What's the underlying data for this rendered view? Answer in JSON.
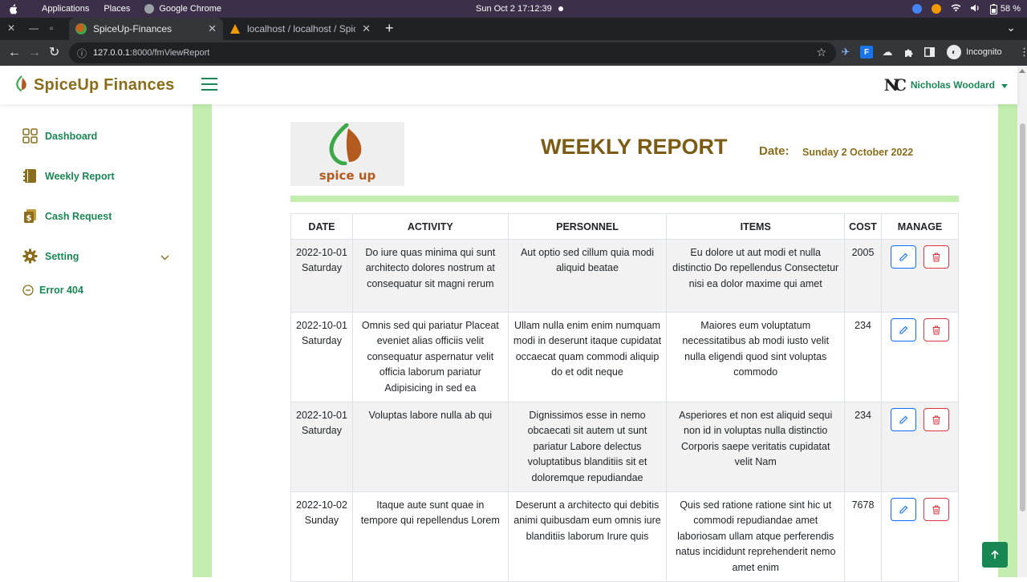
{
  "os_bar": {
    "applications": "Applications",
    "places": "Places",
    "browser": "Google Chrome",
    "clock": "Sun Oct 2  17:12:39",
    "battery": "58 %"
  },
  "browser": {
    "tabs": [
      {
        "title": "SpiceUp-Finances",
        "active": true
      },
      {
        "title": "localhost / localhost / Spic",
        "active": false
      }
    ],
    "url_host": "127.0.0.1",
    "url_path": ":8000/fmViewReport",
    "profile_label": "Incognito"
  },
  "app": {
    "brand": "SpiceUp Finances",
    "user_name": "Nicholas Woodard",
    "user_initials": "NC"
  },
  "sidebar": {
    "items": [
      {
        "label": "Dashboard",
        "icon": "grid-icon"
      },
      {
        "label": "Weekly Report",
        "icon": "notebook-icon"
      },
      {
        "label": "Cash Request",
        "icon": "cash-icon"
      },
      {
        "label": "Setting",
        "icon": "gear-icon"
      },
      {
        "label": "Error 404",
        "icon": "minus-circle-icon"
      }
    ]
  },
  "report": {
    "logo_text": "spice up",
    "title": "WEEKLY REPORT",
    "date_label": "Date:",
    "date_value": "Sunday 2 October 2022",
    "columns": [
      "DATE",
      "ACTIVITY",
      "PERSONNEL",
      "ITEMS",
      "COST",
      "MANAGE"
    ],
    "rows": [
      {
        "date": "2022-10-01 Saturday",
        "activity": "Do iure quas minima qui sunt architecto dolores nostrum at consequatur sit magni rerum",
        "personnel": "Aut optio sed cillum quia modi aliquid beatae",
        "items": "Eu dolore ut aut modi et nulla distinctio Do repellendus Consectetur nisi ea dolor maxime qui amet",
        "cost": "2005"
      },
      {
        "date": "2022-10-01 Saturday",
        "activity": "Omnis sed qui pariatur Placeat eveniet alias officiis velit consequatur aspernatur velit officia laborum pariatur Adipisicing in sed ea",
        "personnel": "Ullam nulla enim enim numquam modi in deserunt itaque cupidatat occaecat quam commodi aliquip do et odit neque",
        "items": "Maiores eum voluptatum necessitatibus ab modi iusto velit nulla eligendi quod sint voluptas commodo",
        "cost": "234"
      },
      {
        "date": "2022-10-01 Saturday",
        "activity": "Voluptas labore nulla ab qui",
        "personnel": "Dignissimos esse in nemo obcaecati sit autem ut sunt pariatur Labore delectus voluptatibus blanditiis sit et doloremque repudiandae",
        "items": "Asperiores et non est aliquid sequi non id in voluptas nulla distinctio Corporis saepe veritatis cupidatat velit Nam",
        "cost": "234"
      },
      {
        "date": "2022-10-02 Sunday",
        "activity": "Itaque aute sunt quae in tempore qui repellendus Lorem",
        "personnel": "Deserunt a architecto qui debitis animi quibusdam eum omnis iure blanditiis laborum Irure quis",
        "items": "Quis sed ratione ratione sint hic ut commodi repudiandae amet laboriosam ullam atque perferendis natus incididunt reprehenderit nemo amet enim",
        "cost": "7678"
      }
    ]
  },
  "colors": {
    "brand_brown": "#8a6d1a",
    "title_brown": "#7c5c14",
    "nav_green": "#198754",
    "light_green": "#c3eeb0",
    "edit_blue": "#0d6efd",
    "delete_red": "#dc3545"
  }
}
